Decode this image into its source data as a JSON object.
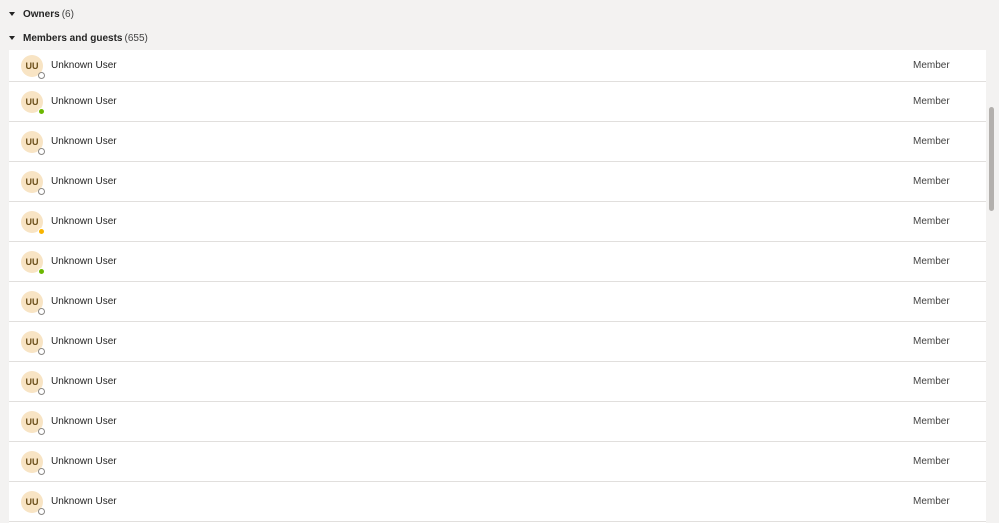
{
  "sections": {
    "owners": {
      "title": "Owners",
      "count": "(6)"
    },
    "members": {
      "title": "Members and guests",
      "count": "(655)"
    }
  },
  "members": [
    {
      "initials": "UU",
      "name": "Unknown User",
      "role": "Member",
      "status": "offline"
    },
    {
      "initials": "UU",
      "name": "Unknown User",
      "role": "Member",
      "status": "available"
    },
    {
      "initials": "UU",
      "name": "Unknown User",
      "role": "Member",
      "status": "offline"
    },
    {
      "initials": "UU",
      "name": "Unknown User",
      "role": "Member",
      "status": "offline"
    },
    {
      "initials": "UU",
      "name": "Unknown User",
      "role": "Member",
      "status": "away"
    },
    {
      "initials": "UU",
      "name": "Unknown User",
      "role": "Member",
      "status": "available"
    },
    {
      "initials": "UU",
      "name": "Unknown User",
      "role": "Member",
      "status": "offline"
    },
    {
      "initials": "UU",
      "name": "Unknown User",
      "role": "Member",
      "status": "offline"
    },
    {
      "initials": "UU",
      "name": "Unknown User",
      "role": "Member",
      "status": "offline"
    },
    {
      "initials": "UU",
      "name": "Unknown User",
      "role": "Member",
      "status": "offline"
    },
    {
      "initials": "UU",
      "name": "Unknown User",
      "role": "Member",
      "status": "offline"
    },
    {
      "initials": "UU",
      "name": "Unknown User",
      "role": "Member",
      "status": "offline"
    }
  ],
  "colors": {
    "avatar_bg": "#f8e4c4",
    "available": "#6bb700",
    "away": "#f8b400",
    "offline": "#8a8886"
  }
}
